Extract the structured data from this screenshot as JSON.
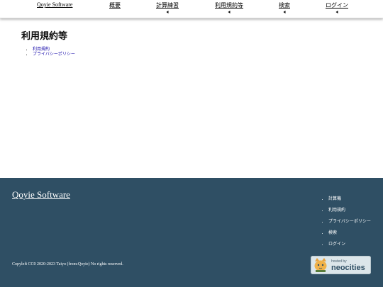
{
  "nav": {
    "brand": "Qoyie Software",
    "items": [
      {
        "label": "概要"
      },
      {
        "label": "計算練習"
      },
      {
        "label": "利用規約等"
      },
      {
        "label": "検索"
      },
      {
        "label": "ログイン"
      }
    ]
  },
  "main": {
    "title": "利用規約等",
    "toc": [
      "利用規約",
      "プライバシーポリシー"
    ]
  },
  "footer": {
    "brand": "Qoyie Software",
    "links": [
      "計算機",
      "利用規約",
      "プライバシーポリシー",
      "検索",
      "ログイン"
    ],
    "copyright": {
      "prefix": "Copyleft",
      "cc0": "CC0",
      "middle": "2020-2023 Taiyo (from:",
      "qoyie": "Qoyie",
      "suffix": ") No rights reserved."
    },
    "badge": {
      "small": "hosted by",
      "big": "neocities"
    }
  },
  "colors": {
    "footer_bg": "#2f4f64",
    "link": "#1a0dab"
  }
}
